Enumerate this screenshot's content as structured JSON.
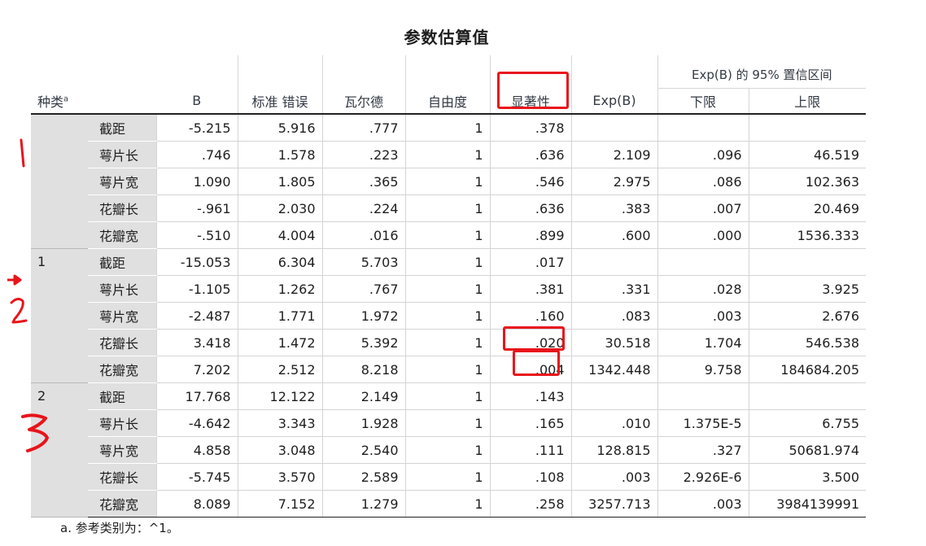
{
  "title": "参数估算值",
  "header": {
    "category": "种类",
    "category_sup": "a",
    "ci_group": "Exp(B) 的 95% 置信区间",
    "cols": [
      "B",
      "标准 错误",
      "瓦尔德",
      "自由度",
      "显著性",
      "Exp(B)",
      "下限",
      "上限"
    ]
  },
  "groups": [
    {
      "label": "",
      "rows": [
        {
          "param": "截距",
          "vals": [
            "-5.215",
            "5.916",
            ".777",
            "1",
            ".378",
            "",
            "",
            ""
          ]
        },
        {
          "param": "萼片长",
          "vals": [
            ".746",
            "1.578",
            ".223",
            "1",
            ".636",
            "2.109",
            ".096",
            "46.519"
          ]
        },
        {
          "param": "萼片宽",
          "vals": [
            "1.090",
            "1.805",
            ".365",
            "1",
            ".546",
            "2.975",
            ".086",
            "102.363"
          ]
        },
        {
          "param": "花瓣长",
          "vals": [
            "-.961",
            "2.030",
            ".224",
            "1",
            ".636",
            ".383",
            ".007",
            "20.469"
          ]
        },
        {
          "param": "花瓣宽",
          "vals": [
            "-.510",
            "4.004",
            ".016",
            "1",
            ".899",
            ".600",
            ".000",
            "1536.333"
          ]
        }
      ]
    },
    {
      "label": "1",
      "rows": [
        {
          "param": "截距",
          "vals": [
            "-15.053",
            "6.304",
            "5.703",
            "1",
            ".017",
            "",
            "",
            ""
          ]
        },
        {
          "param": "萼片长",
          "vals": [
            "-1.105",
            "1.262",
            ".767",
            "1",
            ".381",
            ".331",
            ".028",
            "3.925"
          ]
        },
        {
          "param": "萼片宽",
          "vals": [
            "-2.487",
            "1.771",
            "1.972",
            "1",
            ".160",
            ".083",
            ".003",
            "2.676"
          ]
        },
        {
          "param": "花瓣长",
          "vals": [
            "3.418",
            "1.472",
            "5.392",
            "1",
            ".020",
            "30.518",
            "1.704",
            "546.538"
          ]
        },
        {
          "param": "花瓣宽",
          "vals": [
            "7.202",
            "2.512",
            "8.218",
            "1",
            ".004",
            "1342.448",
            "9.758",
            "184684.205"
          ]
        }
      ]
    },
    {
      "label": "2",
      "rows": [
        {
          "param": "截距",
          "vals": [
            "17.768",
            "12.122",
            "2.149",
            "1",
            ".143",
            "",
            "",
            ""
          ]
        },
        {
          "param": "萼片长",
          "vals": [
            "-4.642",
            "3.343",
            "1.928",
            "1",
            ".165",
            ".010",
            "1.375E-5",
            "6.755"
          ]
        },
        {
          "param": "萼片宽",
          "vals": [
            "4.858",
            "3.048",
            "2.540",
            "1",
            ".111",
            "128.815",
            ".327",
            "50681.974"
          ]
        },
        {
          "param": "花瓣长",
          "vals": [
            "-5.745",
            "3.570",
            "2.589",
            "1",
            ".108",
            ".003",
            "2.926E-6",
            "3.500"
          ]
        },
        {
          "param": "花瓣宽",
          "vals": [
            "8.089",
            "7.152",
            "1.279",
            "1",
            ".258",
            "3257.713",
            ".003",
            "3984139991"
          ]
        }
      ]
    }
  ],
  "footnote": "a. 参考类别为：^1。",
  "highlight_color": "#e8141b"
}
